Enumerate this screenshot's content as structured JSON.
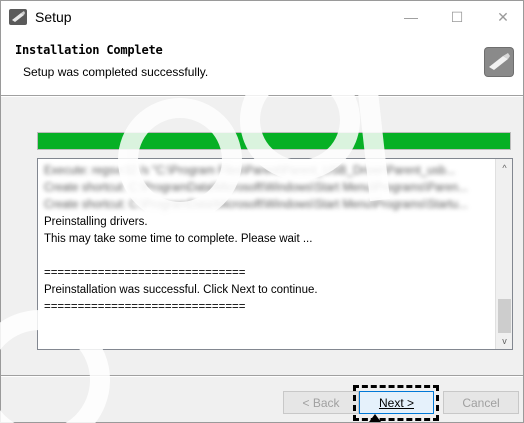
{
  "window": {
    "title": "Setup",
    "controls": {
      "minimize": "—",
      "maximize": "☐",
      "close": "✕"
    }
  },
  "header": {
    "title": "Installation Complete",
    "subtitle": "Setup was completed successfully."
  },
  "progress": {
    "value": 1.0,
    "color": "#06b025"
  },
  "log": {
    "blurred_lines": [
      "Execute: regsvr32 /s \"C:\\Program Files\\Parent\\Parent_USB_Driver\\Parent_usb...",
      "Create shortcut: C:\\ProgramData\\Microsoft\\Windows\\Start Menu\\Programs\\Paren...",
      "Create shortcut: C:\\ProgramData\\Microsoft\\Windows\\Start Menu\\Programs\\Startu..."
    ],
    "lines": [
      "Preinstalling drivers.",
      "This may take some time to complete. Please wait ...",
      "",
      "==============================",
      "Preinstallation was successful. Click Next to continue.",
      "=============================="
    ],
    "scroll_up": "^",
    "scroll_down": "v"
  },
  "buttons": {
    "back": "< Back",
    "next": "Next >",
    "cancel": "Cancel"
  },
  "colors": {
    "accent": "#0078d7",
    "progress": "#06b025",
    "highlight": "#000000"
  }
}
